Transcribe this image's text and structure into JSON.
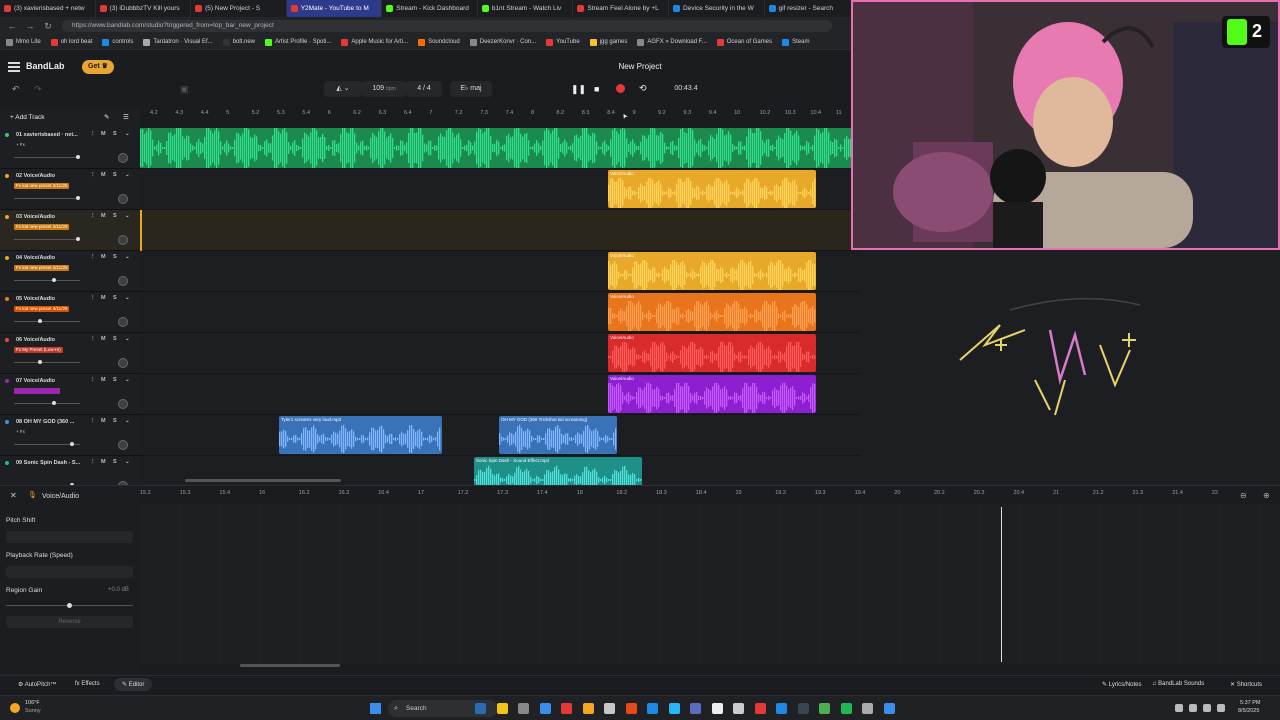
{
  "browser": {
    "tabs": [
      {
        "label": "(3) xavierisbased + netw",
        "color": "#e53935",
        "active": false
      },
      {
        "label": "(3) iDubbbzTV Kill yours",
        "color": "#e53935",
        "active": false
      },
      {
        "label": "(5) New Project - S",
        "color": "#e53935",
        "active": false
      },
      {
        "label": "Y2Mate - YouTube to M",
        "color": "#e53935",
        "active": true
      },
      {
        "label": "Stream - Kick Dashboard",
        "color": "#53fc18",
        "active": false
      },
      {
        "label": "b1nt Stream - Watch Liv",
        "color": "#53fc18",
        "active": false
      },
      {
        "label": "Stream Feel Alone by +L",
        "color": "#e53935",
        "active": false
      },
      {
        "label": "Device Security in the W",
        "color": "#1e88e5",
        "active": false
      },
      {
        "label": "gif resizer - Search",
        "color": "#1e88e5",
        "active": false
      }
    ],
    "url": "https://www.bandlab.com/studio?triggered_from=top_bar_new_project",
    "bookmarks": [
      "Mmo Lite",
      "oh lord beat",
      "controls",
      "Tardatron · Visual Ef...",
      "bolt.new",
      "Artist Profile · Spoti...",
      "Apple Music for Arti...",
      "Soundcloud",
      "DeezerKonvr · Con...",
      "YouTube",
      "jgg games",
      "AGFX » Download F...",
      "Ocean of Games",
      "Steam"
    ]
  },
  "app": {
    "logo": "BandLab",
    "get_label": "Get",
    "project_title": "New Project",
    "bpm": "109",
    "bpm_unit": "bpm",
    "time_sig": "4 / 4",
    "key": "E♭ maj",
    "time": "00:43.4",
    "add_track_label": "Add Track"
  },
  "ruler_top": [
    "4.2",
    "4.3",
    "4.4",
    "5",
    "5.2",
    "5.3",
    "5.4",
    "6",
    "6.2",
    "6.3",
    "6.4",
    "7",
    "7.2",
    "7.3",
    "7.4",
    "8",
    "8.2",
    "8.3",
    "8.4",
    "9",
    "9.2",
    "9.3",
    "9.4",
    "10",
    "10.2",
    "10.3",
    "10.4",
    "11"
  ],
  "tracks": [
    {
      "label": "01 xavierisbased · net...",
      "fx": "+ Fx",
      "fx_color": "transparent",
      "accent": "#2ecc71"
    },
    {
      "label": "02 Voice/Audio",
      "fx": "Fx kat new preset 2/11/25",
      "fx_color": "#c97a12",
      "accent": "#e6a91f"
    },
    {
      "label": "03 Voice/Audio",
      "fx": "Fx kat new preset 2/11/25",
      "fx_color": "#c97a12",
      "accent": "#e6a91f"
    },
    {
      "label": "04 Voice/Audio",
      "fx": "Fx kat new preset 2/11/25",
      "fx_color": "#c97a12",
      "accent": "#e6a91f"
    },
    {
      "label": "05 Voice/Audio",
      "fx": "Fx kat new preset 4/11/25",
      "fx_color": "#d35400",
      "accent": "#e67e22"
    },
    {
      "label": "06 Voice/Audio",
      "fx": "Fx My Preset (Low-Hi)",
      "fx_color": "#c0392b",
      "accent": "#e74c3c"
    },
    {
      "label": "07 Voice/Audio",
      "fx": "",
      "fx_color": "#9b27b0",
      "accent": "#9b27b0"
    },
    {
      "label": "08 OH MY GOD (360 ...",
      "fx": "+ Fx",
      "fx_color": "transparent",
      "accent": "#3498db"
    },
    {
      "label": "09 Sonic Spin Dash - S...",
      "fx": "",
      "fx_color": "transparent",
      "accent": "#1abc9c"
    }
  ],
  "regions": [
    {
      "lane": 1,
      "label": "Voice/Audio",
      "color": "#e8a92a"
    },
    {
      "lane": 3,
      "label": "Voice/Audio",
      "color": "#e8a92a"
    },
    {
      "lane": 4,
      "label": "Voice/Audio",
      "color": "#e8741c"
    },
    {
      "lane": 5,
      "label": "Voice/Audio",
      "color": "#d92b2b"
    },
    {
      "lane": 6,
      "label": "Voice/Audio",
      "color": "#8d1fd1"
    },
    {
      "lane": 7,
      "label": "Tyler1 screams very loud.mp3",
      "color": "#3a72b8"
    },
    {
      "lane": 7,
      "label": "OH MY GOD (360 Trickshot kid screaming)",
      "color": "#3a72b8"
    },
    {
      "lane": 8,
      "label": "Sonic Spin Dash - Sound Effect.mp3",
      "color": "#1f8f8a"
    }
  ],
  "editor": {
    "title": "Voice/Audio",
    "pitch_shift_label": "Pitch Shift",
    "playback_rate_label": "Playback Rate (Speed)",
    "region_gain_label": "Region Gain",
    "region_gain_value": "+0.0 dB",
    "reverse_label": "Reverse",
    "ruler": [
      "15.2",
      "15.3",
      "15.4",
      "16",
      "16.2",
      "16.3",
      "16.4",
      "17",
      "17.2",
      "17.3",
      "17.4",
      "18",
      "18.2",
      "18.3",
      "18.4",
      "19",
      "19.2",
      "19.3",
      "19.4",
      "20",
      "20.2",
      "20.3",
      "20.4",
      "21",
      "21.2",
      "21.3",
      "21.4",
      "22"
    ]
  },
  "bottom": {
    "autopitch": "AutoPitch™",
    "effects": "Effects",
    "editor": "Editor",
    "lyrics": "Lyrics/Notes",
    "sounds": "BandLab Sounds",
    "shortcuts": "Shortcuts"
  },
  "taskbar": {
    "weather_temp": "106°F",
    "weather_desc": "Sunny",
    "search": "Search",
    "time": "5:37 PM",
    "date": "8/5/2025"
  },
  "overlay": {
    "badge": "2"
  }
}
